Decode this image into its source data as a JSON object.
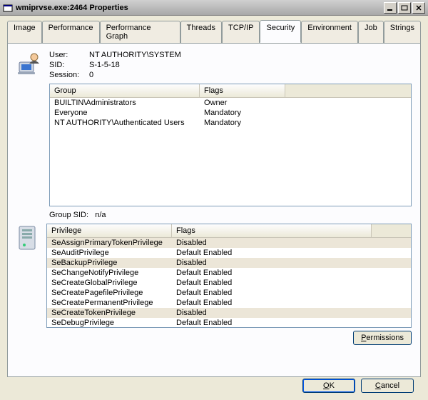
{
  "window": {
    "title": "wmiprvse.exe:2464 Properties"
  },
  "tabs": {
    "image": "Image",
    "performance": "Performance",
    "performance_graph": "Performance Graph",
    "threads": "Threads",
    "tcpip": "TCP/IP",
    "security": "Security",
    "environment": "Environment",
    "job": "Job",
    "strings": "Strings"
  },
  "info": {
    "user_label": "User:",
    "user_value": "NT AUTHORITY\\SYSTEM",
    "sid_label": "SID:",
    "sid_value": "S-1-5-18",
    "session_label": "Session:",
    "session_value": "0"
  },
  "groups_table": {
    "cols": {
      "group": "Group",
      "flags": "Flags"
    },
    "rows": [
      {
        "group": "BUILTIN\\Administrators",
        "flags": "Owner"
      },
      {
        "group": "Everyone",
        "flags": "Mandatory"
      },
      {
        "group": "NT AUTHORITY\\Authenticated Users",
        "flags": "Mandatory"
      }
    ]
  },
  "group_sid": {
    "label": "Group SID:",
    "value": "n/a"
  },
  "priv_table": {
    "cols": {
      "privilege": "Privilege",
      "flags": "Flags"
    },
    "rows": [
      {
        "priv": "SeAssignPrimaryTokenPrivilege",
        "flags": "Disabled",
        "disabled": true
      },
      {
        "priv": "SeAuditPrivilege",
        "flags": "Default Enabled",
        "disabled": false
      },
      {
        "priv": "SeBackupPrivilege",
        "flags": "Disabled",
        "disabled": true
      },
      {
        "priv": "SeChangeNotifyPrivilege",
        "flags": "Default Enabled",
        "disabled": false
      },
      {
        "priv": "SeCreateGlobalPrivilege",
        "flags": "Default Enabled",
        "disabled": false
      },
      {
        "priv": "SeCreatePagefilePrivilege",
        "flags": "Default Enabled",
        "disabled": false
      },
      {
        "priv": "SeCreatePermanentPrivilege",
        "flags": "Default Enabled",
        "disabled": false
      },
      {
        "priv": "SeCreateTokenPrivilege",
        "flags": "Disabled",
        "disabled": true
      },
      {
        "priv": "SeDebugPrivilege",
        "flags": "Default Enabled",
        "disabled": false
      }
    ]
  },
  "buttons": {
    "permissions": "Permissions",
    "ok": "OK",
    "cancel": "Cancel"
  }
}
